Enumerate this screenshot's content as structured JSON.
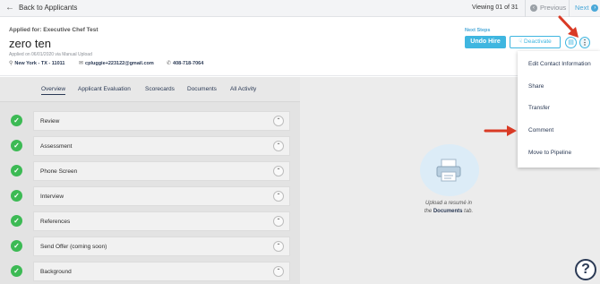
{
  "topbar": {
    "back_label": "Back to Applicants",
    "viewing": "Viewing 01 of 31",
    "previous": "Previous",
    "next": "Next"
  },
  "candidate": {
    "applied_for": "Applied for: Executive Chef Test",
    "name": "zero ten",
    "upload_note": "Applied on 06/01/2020 via Manual Upload",
    "location": "New York - TX - 11011",
    "email": "cpluggie+223122@gmail.com",
    "phone": "408-718-7064"
  },
  "actions": {
    "next_steps_label": "Next Steps",
    "undo_hire": "Undo Hire",
    "deactivate": "Deactivate"
  },
  "tabs": [
    "Overview",
    "Applicant Evaluation",
    "Scorecards",
    "Documents",
    "All Activity"
  ],
  "steps": [
    "Review",
    "Assessment",
    "Phone Screen",
    "Interview",
    "References",
    "Send Offer (coming soon)",
    "Background"
  ],
  "upload": {
    "line1": "Upload a resumé in",
    "the": "the",
    "documents": "Documents",
    "tab": "tab."
  },
  "menu": [
    "Edit Contact Information",
    "Share",
    "Transfer",
    "Comment",
    "Move to Pipeline"
  ],
  "help": "?",
  "colors": {
    "accent": "#3fb6e0",
    "success": "#3cba54",
    "annotation_arrow": "#d93a25",
    "text_dark": "#2b3a55"
  }
}
